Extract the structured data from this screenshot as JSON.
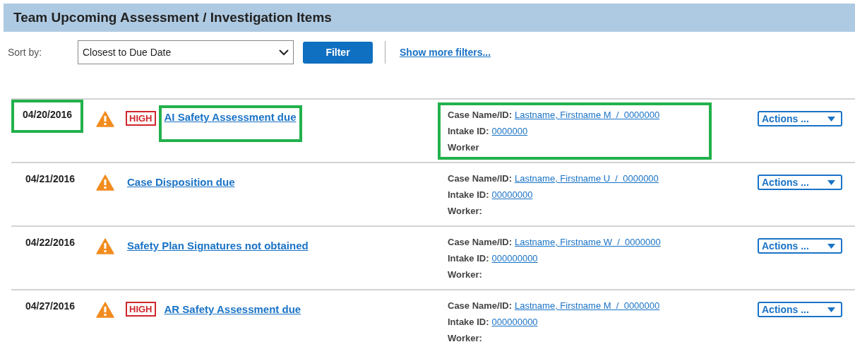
{
  "panel": {
    "title": "Team Upcoming Assessment / Investigation Items"
  },
  "toolbar": {
    "sort_label": "Sort by:",
    "sort_value": "Closest to Due Date",
    "filter_button": "Filter",
    "more_filters_link": "Show more filters..."
  },
  "items": [
    {
      "date": "04/20/2016",
      "priority": "HIGH",
      "title": "AI Safety Assessment due",
      "case_label": "Case Name/ID:",
      "case_value": "Lastname, Firstname M  /  0000000",
      "intake_label": "Intake ID:",
      "intake_value": "0000000",
      "worker_label": "Worker",
      "actions": "Actions ...",
      "highlight_date": true,
      "highlight_title": true,
      "highlight_case": true
    },
    {
      "date": "04/21/2016",
      "title": "Case Disposition due",
      "case_label": "Case Name/ID:",
      "case_value": "Lastname, Firstname U  /  0000000",
      "intake_label": "Intake ID:",
      "intake_value": "00000000",
      "worker_label": "Worker:",
      "actions": "Actions ...",
      "highlight_date": false,
      "highlight_title": false,
      "highlight_case": false
    },
    {
      "date": "04/22/2016",
      "title": "Safety Plan Signatures not obtained",
      "case_label": "Case Name/ID:",
      "case_value": "Lastname, Firstname W  /  0000000",
      "intake_label": "Intake ID:",
      "intake_value": "000000000",
      "worker_label": "Worker:",
      "actions": "Actions ...",
      "highlight_date": false,
      "highlight_title": false,
      "highlight_case": false
    },
    {
      "date": "04/27/2016",
      "priority": "HIGH",
      "title": "AR Safety Assessment due",
      "case_label": "Case Name/ID:",
      "case_value": "Lastname, Firstname M  /  0000000",
      "intake_label": "Intake ID:",
      "intake_value": "000000000",
      "worker_label": "Worker:",
      "actions": "Actions ...",
      "highlight_date": false,
      "highlight_title": false,
      "highlight_case": false
    }
  ]
}
